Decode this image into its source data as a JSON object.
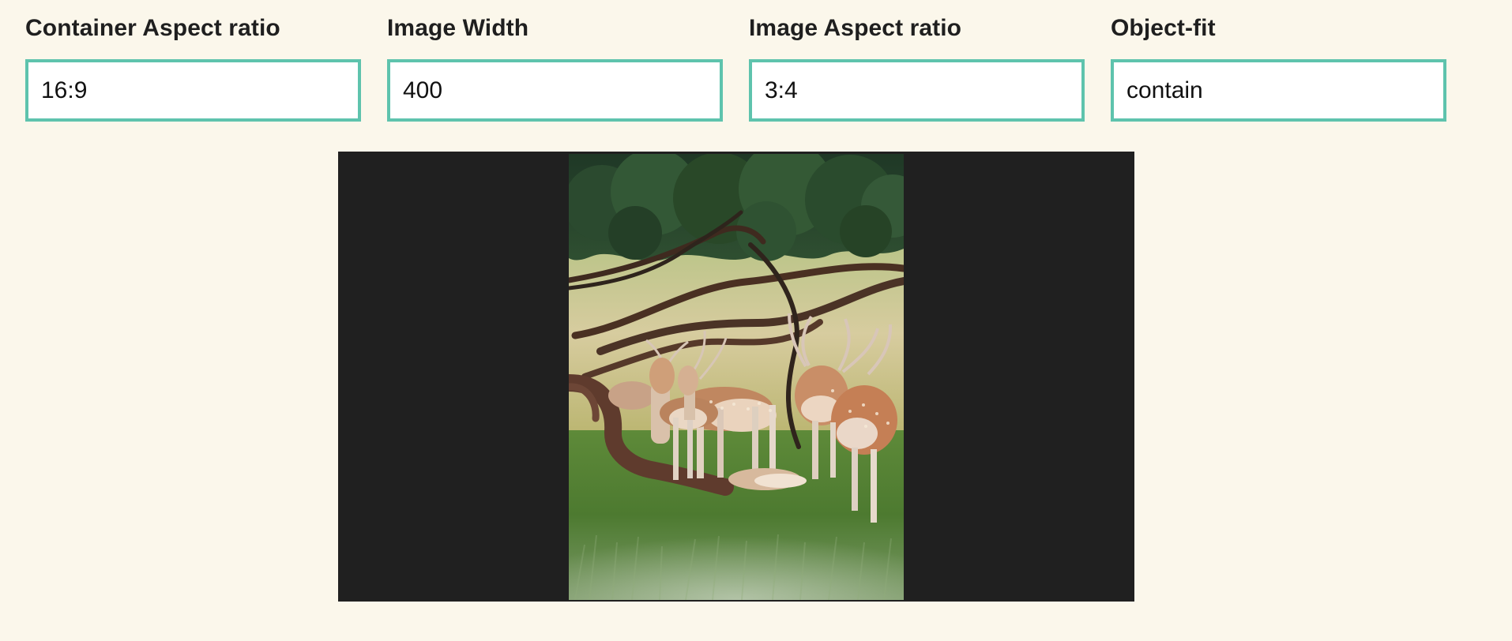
{
  "controls": [
    {
      "label": "Container Aspect ratio",
      "value": "16:9"
    },
    {
      "label": "Image Width",
      "value": "400"
    },
    {
      "label": "Image Aspect ratio",
      "value": "3:4"
    },
    {
      "label": "Object-fit",
      "value": "contain"
    }
  ],
  "colors": {
    "page_background": "#fbf7eb",
    "input_border": "#5ec3ad",
    "container_background": "#202020"
  },
  "image": {
    "subject": "deer-herd-under-tree-photo"
  }
}
